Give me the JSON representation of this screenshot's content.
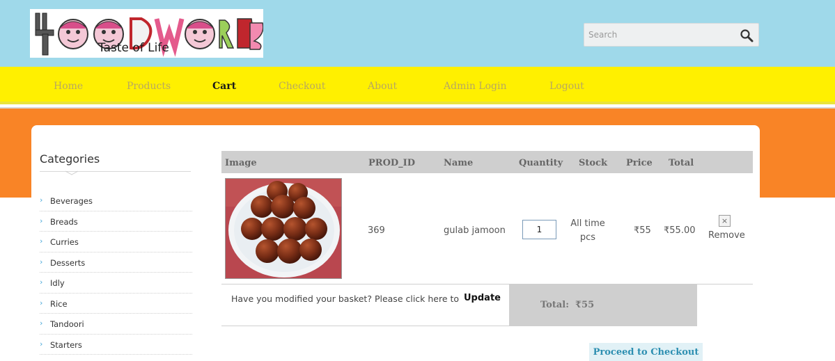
{
  "header": {
    "logo_alt": "FoodWorld",
    "tagline": "Taste of Life",
    "search": {
      "placeholder": "Search",
      "icon": "search-icon"
    }
  },
  "nav": {
    "items": [
      {
        "label": "Home"
      },
      {
        "label": "Products"
      },
      {
        "label": "Cart",
        "active": true
      },
      {
        "label": "Checkout"
      },
      {
        "label": "About"
      },
      {
        "label": "Admin Login"
      },
      {
        "label": "Logout"
      }
    ]
  },
  "sidebar": {
    "title": "Categories",
    "items": [
      {
        "label": "Beverages"
      },
      {
        "label": "Breads"
      },
      {
        "label": "Curries"
      },
      {
        "label": "Desserts"
      },
      {
        "label": "Idly"
      },
      {
        "label": "Rice"
      },
      {
        "label": "Tandoori"
      },
      {
        "label": "Starters"
      }
    ]
  },
  "cart": {
    "columns": {
      "image": "Image",
      "prod_id": "PROD_ID",
      "name": "Name",
      "quantity": "Quantity",
      "stock": "Stock",
      "price": "Price",
      "total": "Total"
    },
    "row": {
      "prod_id": "369",
      "name": "gulab jamoon",
      "quantity": "1",
      "stock": "All time\npcs",
      "price": "₹55",
      "total": "₹55.00",
      "remove_icon": "×",
      "remove_label": "Remove"
    },
    "basket_prompt": "Have you modified your basket? Please click here to",
    "update_label": "Update",
    "total_label": "Total:",
    "total_value": "₹55",
    "checkout_label": "Proceed to Checkout"
  },
  "colors": {
    "header_bg": "#9fd9ea",
    "nav_bg": "#fff000",
    "band_bg": "#f98426",
    "table_head_bg": "#cfcfcf",
    "checkout_text": "#2d8fb1"
  }
}
